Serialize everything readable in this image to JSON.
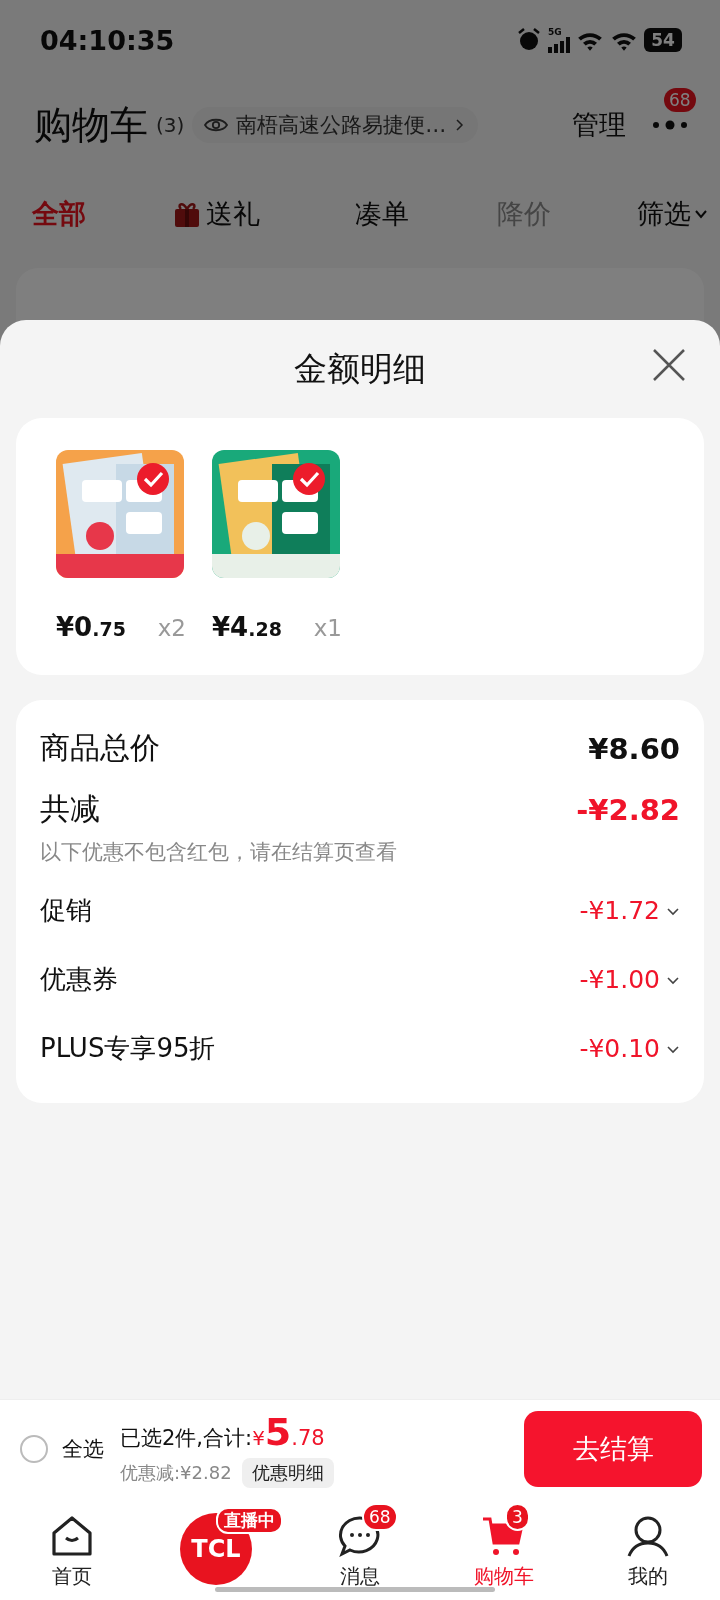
{
  "status_bar": {
    "time": "04:10:35",
    "network": "5G",
    "battery": "54"
  },
  "header": {
    "title": "购物车",
    "count": "(3)",
    "address": "南梧高速公路易捷便…",
    "manage": "管理",
    "more_badge": "68"
  },
  "tabs": [
    {
      "label": "全部",
      "selected": true,
      "disabled": false,
      "kind": "plain"
    },
    {
      "label": "送礼",
      "selected": false,
      "disabled": false,
      "kind": "gift"
    },
    {
      "label": "凑单",
      "selected": false,
      "disabled": false,
      "kind": "plain"
    },
    {
      "label": "降价",
      "selected": false,
      "disabled": true,
      "kind": "plain"
    },
    {
      "label": "筛选",
      "selected": false,
      "disabled": false,
      "kind": "filter"
    }
  ],
  "sheet": {
    "title": "金额明细",
    "items": [
      {
        "kind": "picture",
        "selected": true,
        "price_main": "¥0",
        "price_fraction": ".75",
        "quantity": "x2"
      },
      {
        "kind": "picture",
        "selected": true,
        "price_main": "¥4",
        "price_fraction": ".28",
        "quantity": "x1"
      }
    ],
    "rows": [
      {
        "kind": "total",
        "label": "商品总价",
        "value": "¥8.60"
      },
      {
        "kind": "discount",
        "label": "共减",
        "value": "-¥2.82",
        "note": "以下优惠不包含红包，请在结算页查看"
      },
      {
        "kind": "detail",
        "label": "促销",
        "value": "-¥1.72",
        "expanded": false
      },
      {
        "kind": "detail",
        "label": "优惠券",
        "value": "-¥1.00",
        "expanded": false
      },
      {
        "kind": "detail",
        "label": "PLUS专享95折",
        "value": "-¥0.10",
        "expanded": false
      }
    ]
  },
  "bottom_bar": {
    "select_all": {
      "label": "全选",
      "checked": false
    },
    "summary": "已选2件,合计:",
    "currency": "¥",
    "total_main": "5",
    "total_fraction": ".78",
    "saved": "优惠减:¥2.82",
    "detail_button": "优惠明细",
    "checkout": "去结算"
  },
  "nav": [
    {
      "kind": "home",
      "label": "首页",
      "selected": false
    },
    {
      "kind": "live",
      "logo": "TCL",
      "badge": "直播中"
    },
    {
      "kind": "message",
      "label": "消息",
      "badge": "68",
      "selected": false
    },
    {
      "kind": "cart",
      "label": "购物车",
      "badge": "3",
      "selected": true
    },
    {
      "kind": "profile",
      "label": "我的",
      "selected": false
    }
  ]
}
